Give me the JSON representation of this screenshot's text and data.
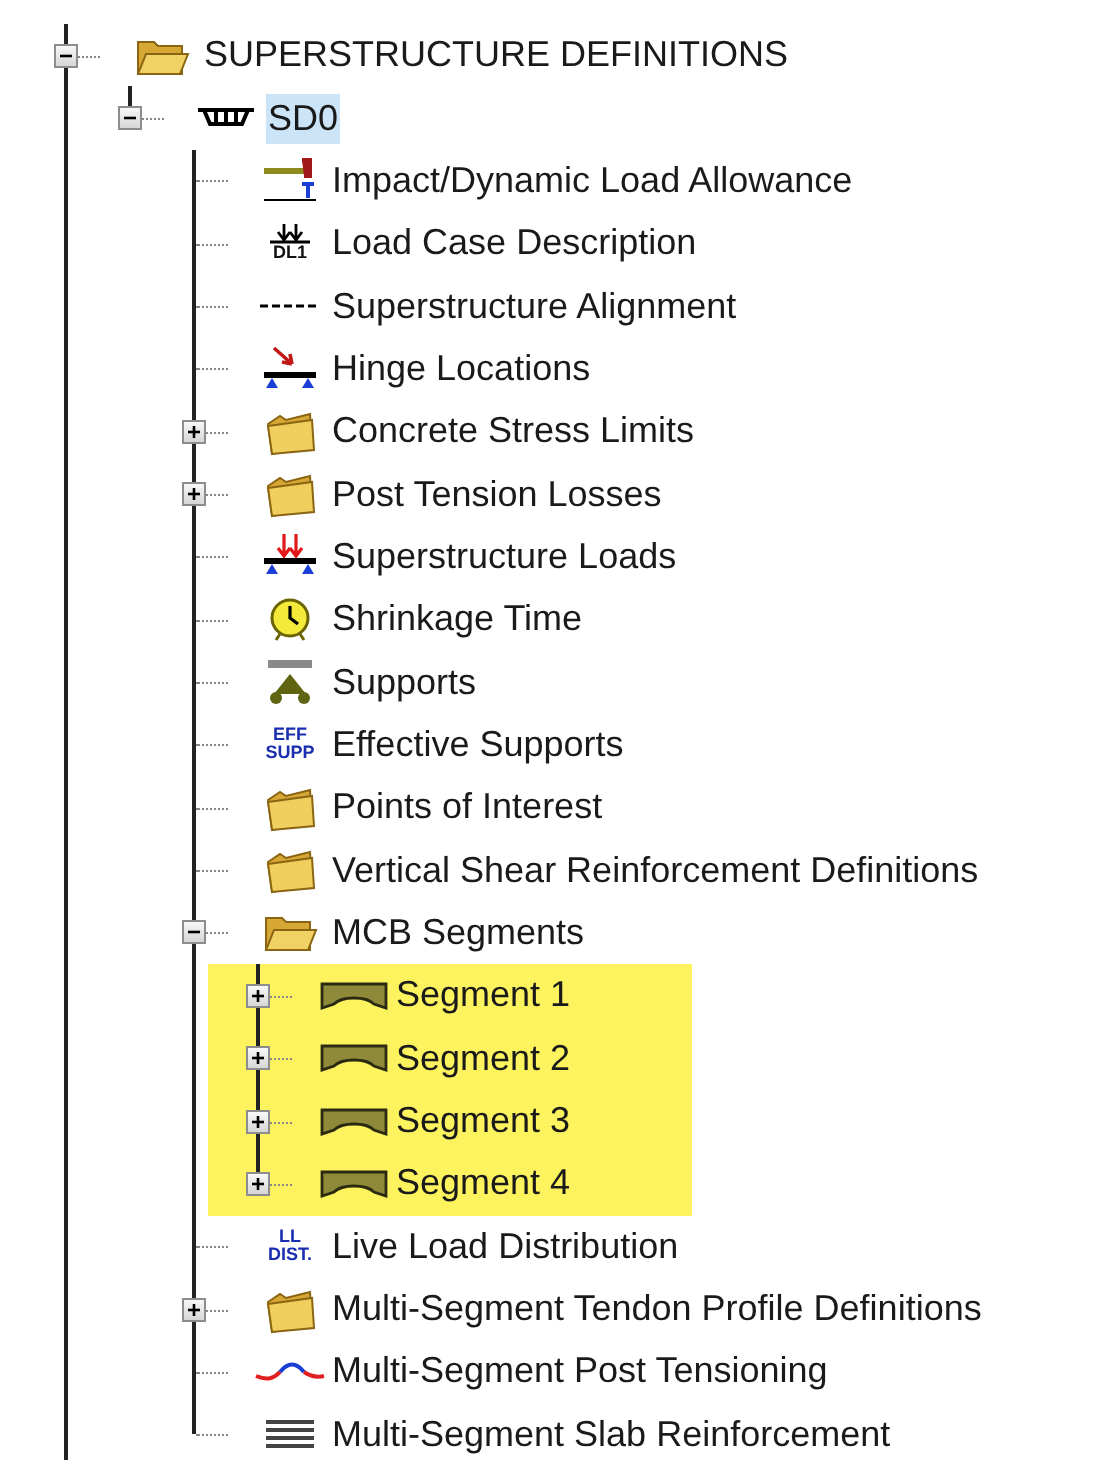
{
  "tree": [
    {
      "label": "SUPERSTRUCTURE DEFINITIONS",
      "kind": "folder-open",
      "expanded": true,
      "selected": false,
      "children": [
        {
          "label": "SD0",
          "kind": "deck",
          "expanded": true,
          "selected": true,
          "children": [
            {
              "label": "Impact/Dynamic Load Allowance",
              "kind": "impact",
              "selected": false
            },
            {
              "label": "Load Case Description",
              "kind": "load-case",
              "icon_text": [
                "DL1"
              ],
              "selected": false
            },
            {
              "label": "Superstructure Alignment",
              "kind": "dashes",
              "selected": false
            },
            {
              "label": "Hinge Locations",
              "kind": "hinge",
              "selected": false
            },
            {
              "label": "Concrete Stress Limits",
              "kind": "folder",
              "expanded": false,
              "selected": false
            },
            {
              "label": "Post Tension Losses",
              "kind": "folder",
              "expanded": false,
              "selected": false
            },
            {
              "label": "Superstructure Loads",
              "kind": "loads",
              "selected": false
            },
            {
              "label": "Shrinkage Time",
              "kind": "clock",
              "selected": false
            },
            {
              "label": "Supports",
              "kind": "supports",
              "selected": false
            },
            {
              "label": "Effective Supports",
              "kind": "text",
              "icon_text": [
                "EFF",
                "SUPP"
              ],
              "selected": false
            },
            {
              "label": "Points of Interest",
              "kind": "folder",
              "selected": false
            },
            {
              "label": "Vertical Shear Reinforcement Definitions",
              "kind": "folder",
              "selected": false
            },
            {
              "label": "MCB Segments",
              "kind": "folder-open",
              "expanded": true,
              "selected": false,
              "children": [
                {
                  "label": "Segment 1",
                  "kind": "segment",
                  "expanded": false,
                  "selected": false,
                  "highlighted": true
                },
                {
                  "label": "Segment 2",
                  "kind": "segment",
                  "expanded": false,
                  "selected": false,
                  "highlighted": true
                },
                {
                  "label": "Segment 3",
                  "kind": "segment",
                  "expanded": false,
                  "selected": false,
                  "highlighted": true
                },
                {
                  "label": "Segment 4",
                  "kind": "segment",
                  "expanded": false,
                  "selected": false,
                  "highlighted": true
                }
              ]
            },
            {
              "label": "Live Load Distribution",
              "kind": "text",
              "icon_text": [
                "LL",
                "DIST."
              ],
              "selected": false
            },
            {
              "label": "Multi-Segment Tendon Profile Definitions",
              "kind": "folder",
              "expanded": false,
              "selected": false
            },
            {
              "label": "Multi-Segment Post Tensioning",
              "kind": "wave",
              "selected": false
            },
            {
              "label": "Multi-Segment Slab Reinforcement",
              "kind": "lines",
              "selected": false
            }
          ]
        }
      ]
    }
  ]
}
